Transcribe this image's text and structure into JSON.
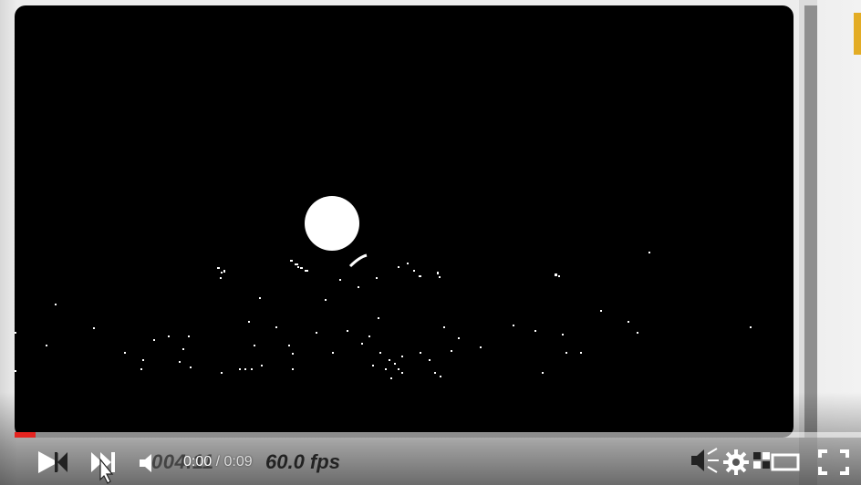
{
  "player": {
    "overlay_counter": "004.11",
    "overlay_fps": "60.0 fps",
    "time": {
      "current": "0:00",
      "separator": " / ",
      "duration": "0:09"
    },
    "progress": 0.025,
    "accent_color": "#e52420"
  },
  "controls": {
    "icons": [
      "play-icon",
      "previous-icon",
      "next-icon",
      "volume-icon",
      "annotation-icon",
      "settings-icon",
      "miniplayer-icon",
      "theater-mode-icon",
      "fullscreen-icon"
    ]
  }
}
